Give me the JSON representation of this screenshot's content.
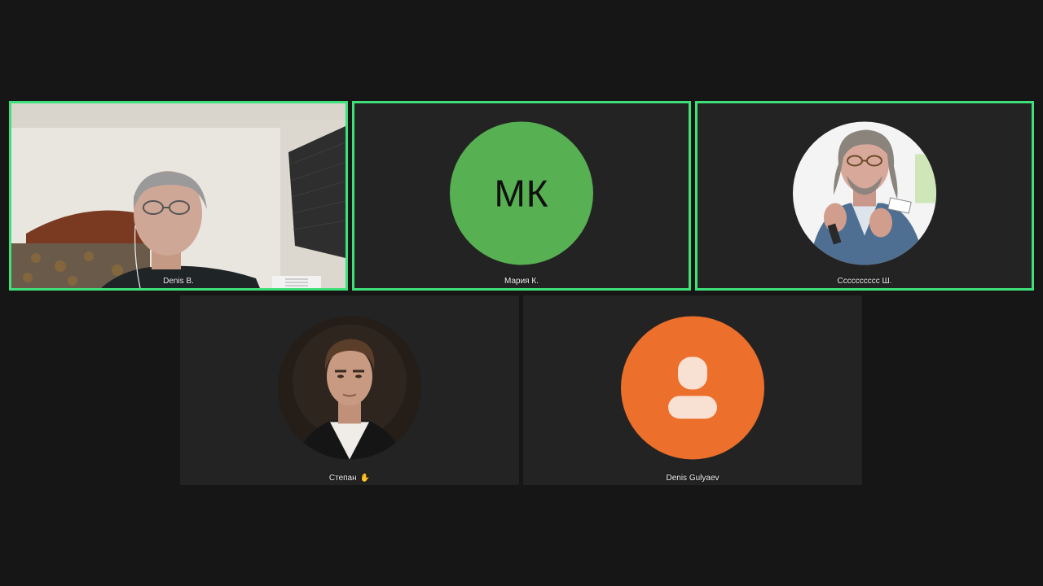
{
  "participants": [
    {
      "name": "Denis B.",
      "speaking": true,
      "avatar_type": "video"
    },
    {
      "name": "Мария К.",
      "speaking": true,
      "avatar_type": "initials",
      "initials": "МК",
      "color": "#57b052"
    },
    {
      "name": "Сссссссссс Ш.",
      "speaking": true,
      "avatar_type": "photo"
    },
    {
      "name": "Степан",
      "speaking": false,
      "avatar_type": "photo",
      "status_icon": "raised-hand-icon"
    },
    {
      "name": "Denis Gulyaev",
      "speaking": false,
      "avatar_type": "placeholder",
      "color": "#ec6f2b"
    }
  ],
  "colors": {
    "background": "#161616",
    "tile": "#232323",
    "speaking_border": "#3ee07a"
  }
}
